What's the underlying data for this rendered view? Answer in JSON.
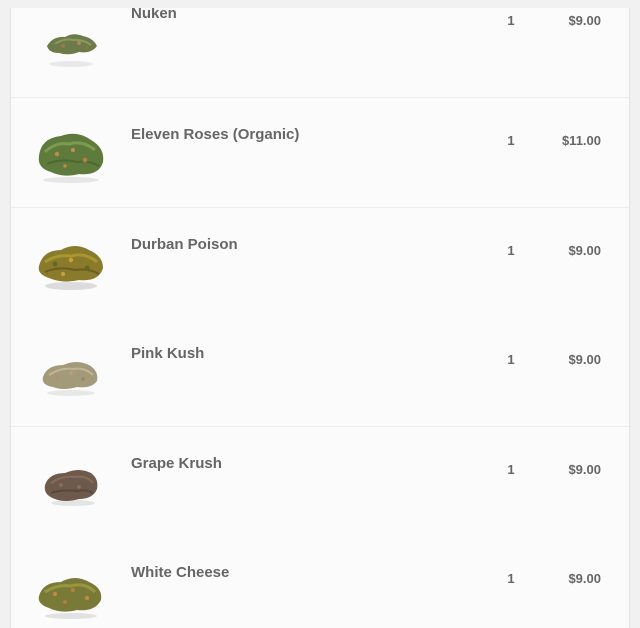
{
  "cart": {
    "items": [
      {
        "name": "Nuken",
        "quantity": "1",
        "price": "$9.00",
        "image": "green-bud-small"
      },
      {
        "name": "Eleven Roses (Organic)",
        "quantity": "1",
        "price": "$11.00",
        "image": "green-bud-large"
      },
      {
        "name": "Durban Poison",
        "quantity": "1",
        "price": "$9.00",
        "image": "golden-bud"
      },
      {
        "name": "Pink Kush",
        "quantity": "1",
        "price": "$9.00",
        "image": "pale-bud"
      },
      {
        "name": "Grape Krush",
        "quantity": "1",
        "price": "$9.00",
        "image": "purple-bud"
      },
      {
        "name": "White Cheese",
        "quantity": "1",
        "price": "$9.00",
        "image": "olive-bud"
      }
    ]
  }
}
